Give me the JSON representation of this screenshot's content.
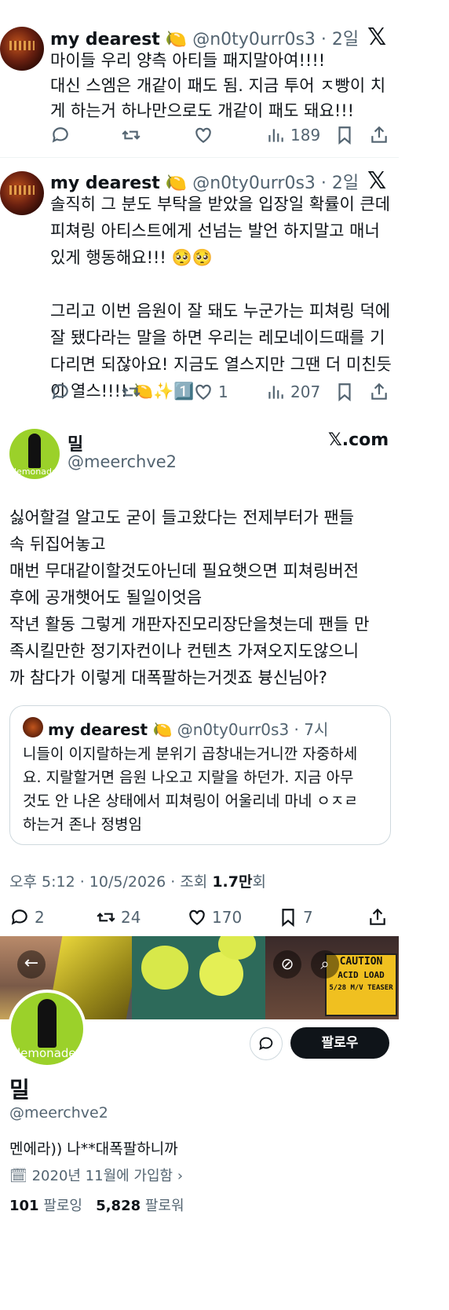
{
  "tweet1": {
    "name": "my dearest",
    "emoji": "🍋",
    "handle": "@n0ty0urr0s3",
    "time": "· 2일",
    "body": "마이들 우리 양측 아티들 패지말아여!!!!\n대신 스엠은 개같이 패도 됨. 지금 투어 ㅈ빵이 치\n게 하는거 하나만으로도 개같이 패도 돼요!!!",
    "views": "189"
  },
  "tweet2": {
    "name": "my dearest",
    "emoji": "🍋",
    "handle": "@n0ty0urr0s3",
    "time": "· 2일",
    "body": "솔직히 그 분도 부탁을 받았을 입장일 확률이 큰데\n피쳐링 아티스트에게 선넘는 발언 하지말고 매너\n있게 행동해요!!! 🥺🥺\n\n그리고 이번 음원이 잘 돼도 누군가는 피쳐링 덕에\n잘 됐다라는 말을 하면 우리는 레모네이드때를 기\n다리면 되잖아요! 지금도 열스지만 그땐 더 미친듯\n이 열스!!!! 🍋✨1️⃣",
    "likes": "1",
    "views": "207"
  },
  "main_tweet": {
    "name": "밀",
    "handle": "@meerchve2",
    "site": ".com",
    "avatar_text": "lemonade",
    "body": "싫어할걸 알고도 굳이 들고왔다는 전제부터가 팬들\n속 뒤집어놓고\n매번 무대같이할것도아닌데 필요햇으면 피쳐링버전\n후에 공개햇어도 될일이엇음\n작년 활동 그렇게 개판자진모리장단을쳣는데 팬들 만\n족시킬만한 정기자컨이나 컨텐츠 가져오지도않으니\n까 참다가 이렇게 대폭팔하는거겟죠 븅신님아?",
    "quote": {
      "name": "my dearest",
      "emoji": "🍋",
      "handle": "@n0ty0urr0s3",
      "time": "· 7시",
      "body": "니들이 이지랄하는게 분위기 곱창내는거니깐 자중하세\n요. 지랄할거면 음원 나오고 지랄을 하던가. 지금 아무\n것도 안 나온 상태에서 피쳐링이 어울리네 마네 ㅇㅈㄹ\n하는거 존나 정병임"
    },
    "meta": "오후 5:12 · 10/5/2026 · 조회 ",
    "meta_views": "1.7만",
    "meta_suffix": "회",
    "replies": "2",
    "retweets": "24",
    "likes": "170",
    "bookmarks": "7"
  },
  "profile": {
    "banner_texts": {
      "caution": "CAUTION",
      "acid": "ACID LOAD",
      "teaser": "5/28 M/V TEASER"
    },
    "avatar_text": "lemonade",
    "follow_label": "팔로우",
    "name": "밀",
    "handle": "@meerchve2",
    "bio": "멘에라)) 나**대폭팔하니까",
    "joined": "2020년 11월에 가입함",
    "following_count": "101",
    "following_label": "팔로잉",
    "followers_count": "5,828",
    "followers_label": "팔로워"
  },
  "colors": {
    "text": "#0f1419",
    "secondary": "#536471",
    "border": "#cfd9de",
    "follow_button": "#0f1419",
    "avatar_green": "#9bd12a"
  }
}
